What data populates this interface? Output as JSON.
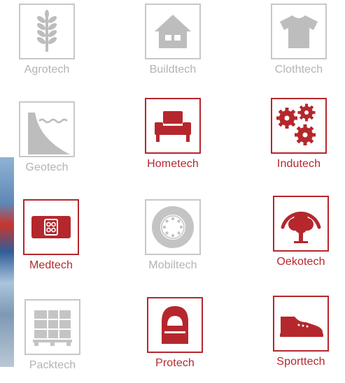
{
  "tiles": [
    {
      "label": "Agrotech",
      "icon": "wheat-icon",
      "active": false
    },
    {
      "label": "Buildtech",
      "icon": "house-icon",
      "active": false
    },
    {
      "label": "Clothtech",
      "icon": "tshirt-icon",
      "active": false
    },
    {
      "label": "Geotech",
      "icon": "dam-icon",
      "active": false
    },
    {
      "label": "Hometech",
      "icon": "armchair-icon",
      "active": true
    },
    {
      "label": "Indutech",
      "icon": "gears-icon",
      "active": true
    },
    {
      "label": "Medtech",
      "icon": "bandage-icon",
      "active": true
    },
    {
      "label": "Mobiltech",
      "icon": "wheel-icon",
      "active": false
    },
    {
      "label": "Oekotech",
      "icon": "tree-icon",
      "active": true
    },
    {
      "label": "Packtech",
      "icon": "pallet-icon",
      "active": false
    },
    {
      "label": "Protech",
      "icon": "protective-hood-icon",
      "active": true
    },
    {
      "label": "Sporttech",
      "icon": "sneaker-icon",
      "active": true
    }
  ],
  "colors": {
    "active": "#b5272d",
    "inactive": "#b3b3b3"
  }
}
